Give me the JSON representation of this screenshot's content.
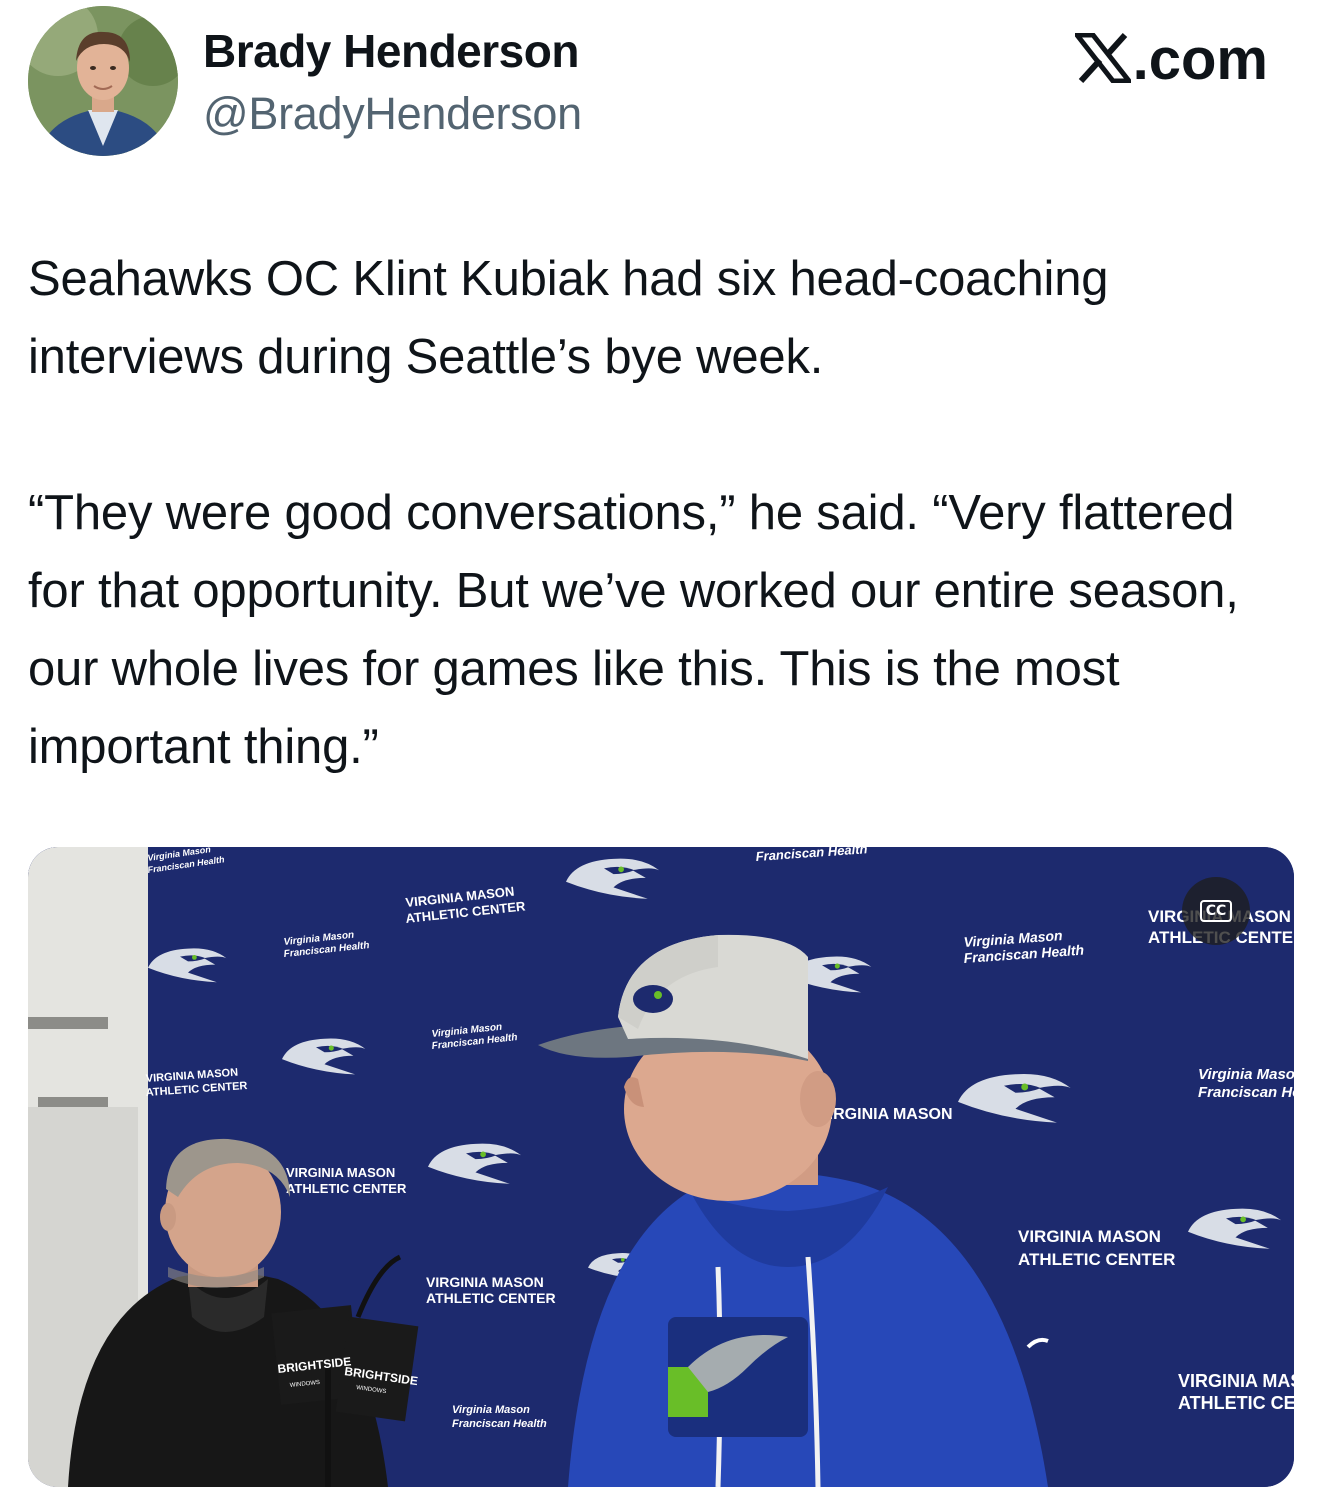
{
  "author": {
    "name": "Brady Henderson",
    "handle": "@BradyHenderson",
    "avatar_icon": "profile-photo"
  },
  "platform": {
    "label": "X.com",
    "logo_text": ".com"
  },
  "tweet": {
    "paragraph1": "Seahawks OC Klint Kubiak had six head-coaching interviews during Seattle’s bye week.",
    "paragraph2": "“They were good conversations,” he said. “Very flattered for that opportunity. But we’ve worked our entire season, our whole lives for games like this. This is the most important thing.”"
  },
  "media": {
    "cc_label": "CC",
    "backdrop_texts": {
      "vm_athletic_1": "VIRGINIA MASON",
      "vm_athletic_2": "ATHLETIC CENTER",
      "vm_health_1": "Virginia Mason",
      "vm_health_2": "Franciscan Health",
      "podium_brand": "BRIGHTSIDE",
      "podium_sub": "WINDOWS"
    },
    "colors": {
      "backdrop": "#1d2a6e",
      "hoodie": "#2748b8",
      "cap_front": "#d9d9d4",
      "seahawks_green": "#69be28"
    }
  }
}
